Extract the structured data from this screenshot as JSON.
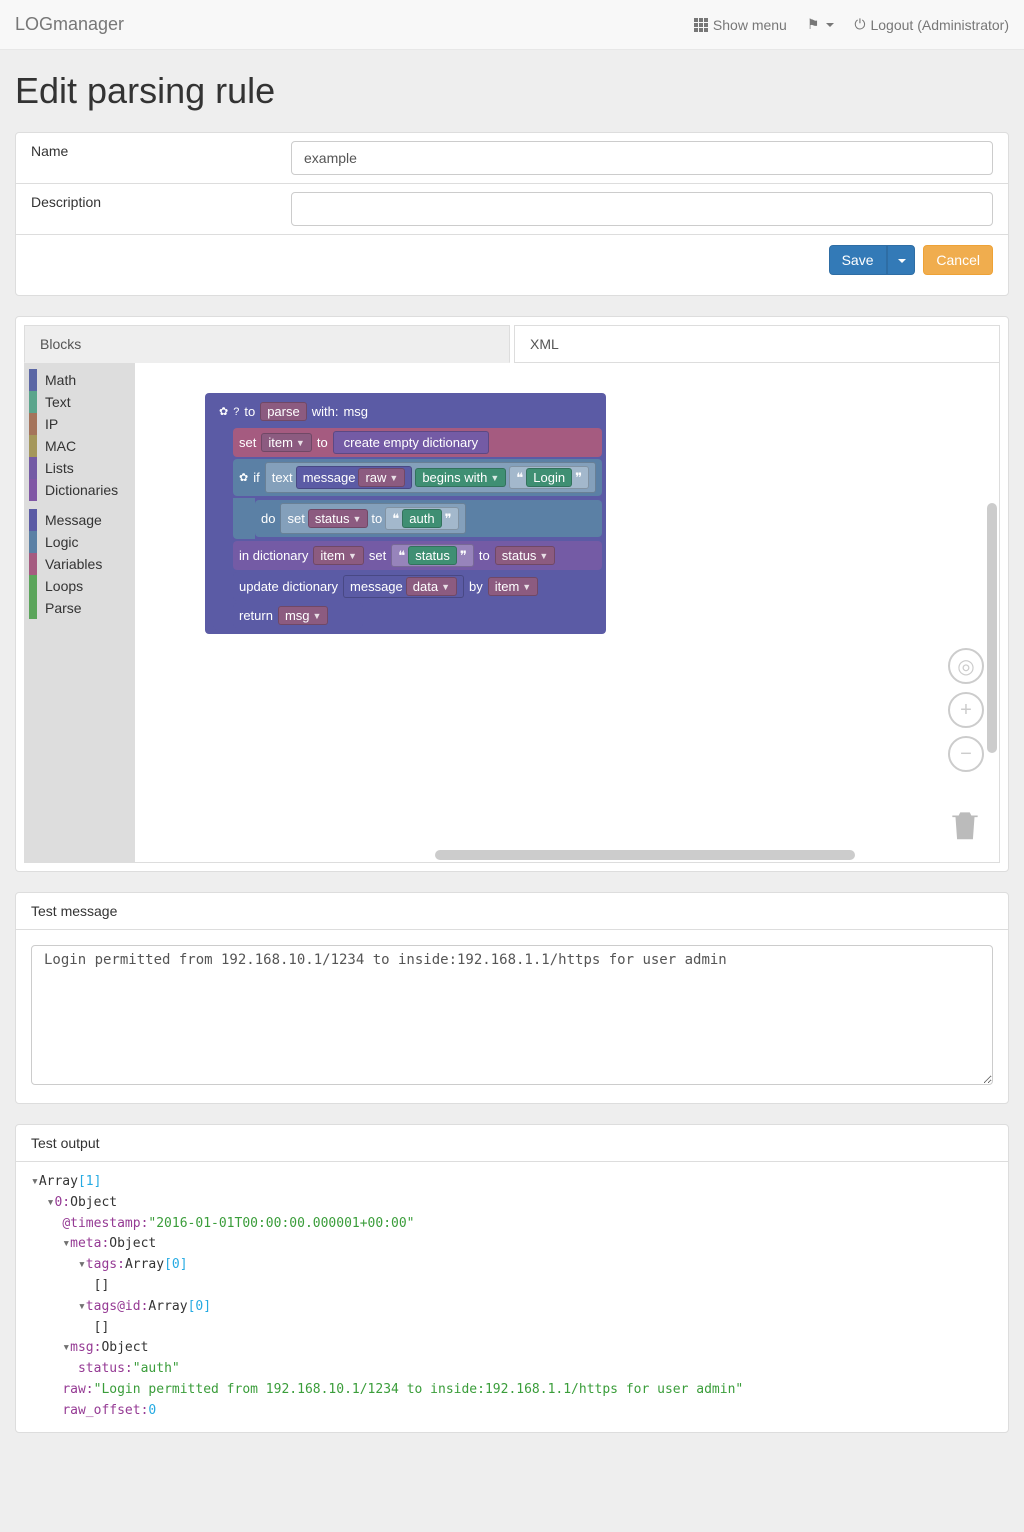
{
  "navbar": {
    "brand": "LOGmanager",
    "show_menu": "Show menu",
    "logout": "Logout (Administrator)"
  },
  "page_title": "Edit parsing rule",
  "form": {
    "name_label": "Name",
    "name_value": "example",
    "desc_label": "Description",
    "desc_value": "",
    "save": "Save",
    "cancel": "Cancel"
  },
  "tabs": {
    "blocks": "Blocks",
    "xml": "XML"
  },
  "toolbox": [
    {
      "label": "Math",
      "color": "#5b67a5"
    },
    {
      "label": "Text",
      "color": "#5ba58c"
    },
    {
      "label": "IP",
      "color": "#a5745b"
    },
    {
      "label": "MAC",
      "color": "#a5975b"
    },
    {
      "label": "Lists",
      "color": "#745ba5"
    },
    {
      "label": "Dictionaries",
      "color": "#8057a5"
    },
    {
      "sep": true
    },
    {
      "label": "Message",
      "color": "#5b5ba5"
    },
    {
      "label": "Logic",
      "color": "#5b80a5"
    },
    {
      "label": "Variables",
      "color": "#a55b80"
    },
    {
      "label": "Loops",
      "color": "#5ba55b"
    },
    {
      "label": "Parse",
      "color": "#5ba55b"
    }
  ],
  "blocks": {
    "to": "to",
    "parse": "parse",
    "with": "with:",
    "msg": "msg",
    "set": "set",
    "item": "item",
    "to2": "to",
    "create_dict": "create empty dictionary",
    "if": "if",
    "text": "text",
    "message": "message",
    "raw": "raw",
    "begins": "begins with",
    "login": "Login",
    "do": "do",
    "status": "status",
    "auth": "auth",
    "indict": "in dictionary",
    "status_q": "status",
    "update": "update dictionary",
    "data": "data",
    "by": "by",
    "return": "return"
  },
  "test_msg": {
    "label": "Test message",
    "value": "Login permitted from 192.168.10.1/1234 to inside:192.168.1.1/https for user admin"
  },
  "test_out": {
    "label": "Test output",
    "array": "Array",
    "one": "[1]",
    "zero_obj": "0:",
    "object": "Object",
    "ts_k": "@timestamp:",
    "ts_v": "\"2016-01-01T00:00:00.000001+00:00\"",
    "meta_k": "meta:",
    "tags_k": "tags:",
    "arr0": "Array",
    "zero": "[0]",
    "brackets": "[]",
    "tagsid_k": "tags@id:",
    "msg_k": "msg:",
    "status_k": "status:",
    "status_v": "\"auth\"",
    "raw_k": "raw:",
    "raw_v": "\"Login permitted from 192.168.10.1/1234 to inside:192.168.1.1/https for user admin\"",
    "rawoff_k": "raw_offset:",
    "rawoff_v": "0"
  }
}
